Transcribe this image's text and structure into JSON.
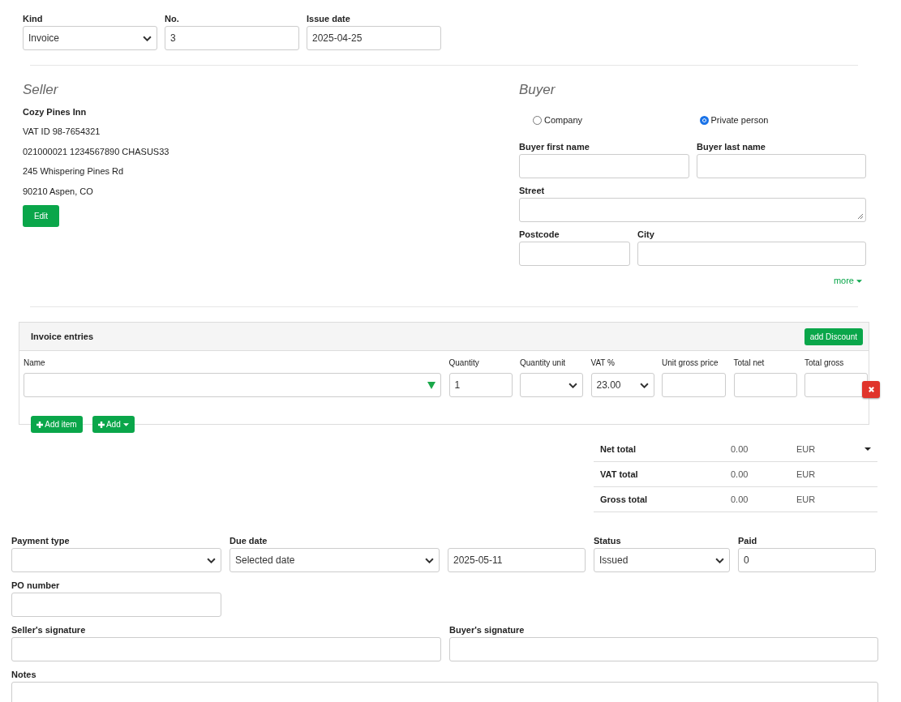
{
  "header": {
    "fields": [
      {
        "label": "Kind",
        "value": "Invoice",
        "kind": "select"
      },
      {
        "label": "No.",
        "value": "3",
        "kind": "text"
      },
      {
        "label": "Issue date",
        "value": "2025-04-25",
        "kind": "text"
      }
    ]
  },
  "seller": {
    "heading": "Seller",
    "name": "Cozy Pines Inn",
    "lines": [
      "VAT ID 98-7654321",
      "021000021 1234567890 CHASUS33",
      "245 Whispering Pines Rd",
      "90210 Aspen, CO"
    ],
    "edit_button": "Edit"
  },
  "buyer": {
    "heading": "Buyer",
    "options": [
      {
        "label": "Company",
        "selected": false
      },
      {
        "label": "Private person",
        "selected": true
      }
    ],
    "rows": [
      [
        {
          "label": "Buyer first name",
          "kind": "text"
        },
        {
          "label": "Buyer last name",
          "kind": "text"
        }
      ],
      [
        {
          "label": "Street",
          "kind": "textarea"
        }
      ],
      [
        {
          "label": "Postcode",
          "kind": "text"
        },
        {
          "label": "City",
          "kind": "text"
        }
      ]
    ],
    "more_link": "more"
  },
  "entries": {
    "title": "Invoice entries",
    "discount_button": "add Discount",
    "columns": [
      "Name",
      "Quantity",
      "Quantity unit",
      "VAT %",
      "Unit gross price",
      "Total net",
      "Total gross"
    ],
    "row": [
      {
        "kind": "combo"
      },
      {
        "kind": "text",
        "value": "1"
      },
      {
        "kind": "select"
      },
      {
        "kind": "select",
        "value": "23.00"
      },
      {
        "kind": "text"
      },
      {
        "kind": "text"
      },
      {
        "kind": "text"
      }
    ],
    "add_item_button": "Add item",
    "add_button": "Add"
  },
  "totals": [
    {
      "label": "Net total",
      "amount": "0.00",
      "currency": "EUR",
      "menu": true
    },
    {
      "label": "VAT total",
      "amount": "0.00",
      "currency": "EUR",
      "menu": false
    },
    {
      "label": "Gross total",
      "amount": "0.00",
      "currency": "EUR",
      "menu": false
    }
  ],
  "footer": {
    "payment_fields": [
      {
        "label": "Payment type",
        "kind": "select"
      },
      {
        "label": "Due date",
        "value": "Selected date",
        "kind": "select"
      },
      {
        "value": "2025-05-11",
        "kind": "text"
      },
      {
        "label": "Status",
        "value": "Issued",
        "kind": "select"
      },
      {
        "label": "Paid",
        "value": "0",
        "kind": "text"
      }
    ],
    "po_number": {
      "label": "PO number"
    },
    "signatures": [
      {
        "label": "Seller's signature"
      },
      {
        "label": "Buyer's signature"
      }
    ],
    "notes": {
      "label": "Notes"
    }
  }
}
